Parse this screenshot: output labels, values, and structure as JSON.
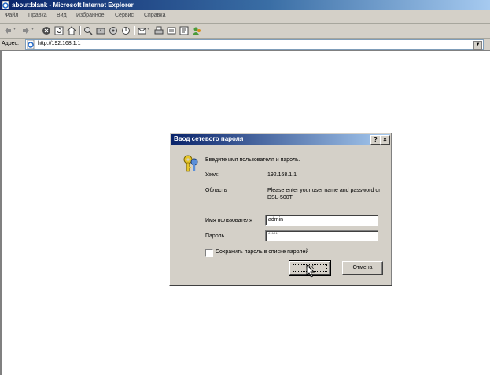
{
  "window": {
    "title": "about:blank - Microsoft Internet Explorer"
  },
  "menu": {
    "items": [
      "Файл",
      "Правка",
      "Вид",
      "Избранное",
      "Сервис",
      "Справка"
    ]
  },
  "toolbar": {
    "icons": [
      "back-icon",
      "forward-icon",
      "stop-icon",
      "refresh-icon",
      "home-icon",
      "search-icon",
      "favorites-icon",
      "media-icon",
      "history-icon",
      "mail-icon",
      "print-icon",
      "edit-icon",
      "discuss-icon",
      "messenger-icon"
    ]
  },
  "address": {
    "label": "Адрес:",
    "url": "http://192.168.1.1"
  },
  "dialog": {
    "title": "Ввод сетевого пароля",
    "help_label": "?",
    "close_label": "×",
    "prompt": "Введите имя пользователя и пароль.",
    "host_label": "Узел:",
    "host_value": "192.168.1.1",
    "realm_label": "Область",
    "realm_value": "Please enter your user name and password on DSL-500T",
    "username_label": "Имя пользователя",
    "username_value": "admin",
    "password_label": "Пароль",
    "password_value": "*****",
    "save_password_label": "Сохранить пароль в списке паролей",
    "save_password_checked": false,
    "ok_label": "OK",
    "cancel_label": "Отмена"
  }
}
